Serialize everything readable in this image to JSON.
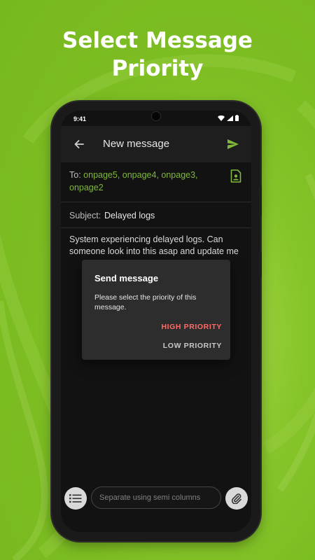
{
  "headline": {
    "line1": "Select Message",
    "line2": "Priority"
  },
  "status_bar": {
    "time": "9:41",
    "icons": [
      "wifi-icon",
      "signal-icon",
      "battery-icon"
    ]
  },
  "app_bar": {
    "title": "New message",
    "back_icon": "arrow-left-icon",
    "send_icon": "send-icon"
  },
  "compose": {
    "to_label": "To:",
    "to_recipients": "onpage5, onpage4, onpage3, onpage2",
    "contact_icon": "contact-card-icon",
    "subject_label": "Subject:",
    "subject_value": "Delayed logs",
    "body": "System experiencing delayed logs. Can someone look into this asap and update me"
  },
  "dialog": {
    "title": "Send message",
    "message": "Please select the priority of this message.",
    "actions": {
      "high": "HIGH PRIORITY",
      "low": "LOW PRIORITY"
    }
  },
  "bottom_bar": {
    "list_icon": "list-icon",
    "input_placeholder": "Separate using semi columns",
    "attach_icon": "paperclip-icon"
  },
  "colors": {
    "background": "#7cbd22",
    "accent": "#7fb83a",
    "high_priority": "#ff6b68",
    "low_priority": "#c8c8c8",
    "dialog_bg": "#2d2d2d",
    "screen_bg": "#121212"
  }
}
